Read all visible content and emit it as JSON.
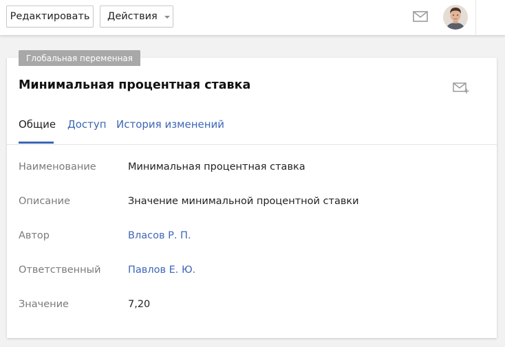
{
  "toolbar": {
    "edit_label": "Редактировать",
    "actions_label": "Действия",
    "mail_icon": "mail-icon",
    "avatar_icon": "user-avatar"
  },
  "card": {
    "badge": "Глобальная переменная",
    "title": "Минимальная процентная ставка",
    "mail_add_icon": "mail-add-icon",
    "tabs": [
      {
        "label": "Общие",
        "active": true
      },
      {
        "label": "Доступ",
        "active": false
      },
      {
        "label": "История изменений",
        "active": false
      }
    ],
    "fields": [
      {
        "label": "Наименование",
        "value": "Минимальная процентная ставка",
        "link": false
      },
      {
        "label": "Описание",
        "value": "Значение минимальной процентной ставки",
        "link": false
      },
      {
        "label": "Автор",
        "value": "Власов Р. П.",
        "link": true
      },
      {
        "label": "Ответственный",
        "value": "Павлов Е. Ю.",
        "link": true
      },
      {
        "label": "Значение",
        "value": "7,20",
        "link": false
      }
    ]
  },
  "colors": {
    "link": "#3d66b5",
    "badge": "#a8a8a8",
    "label": "#7a7a7a"
  }
}
